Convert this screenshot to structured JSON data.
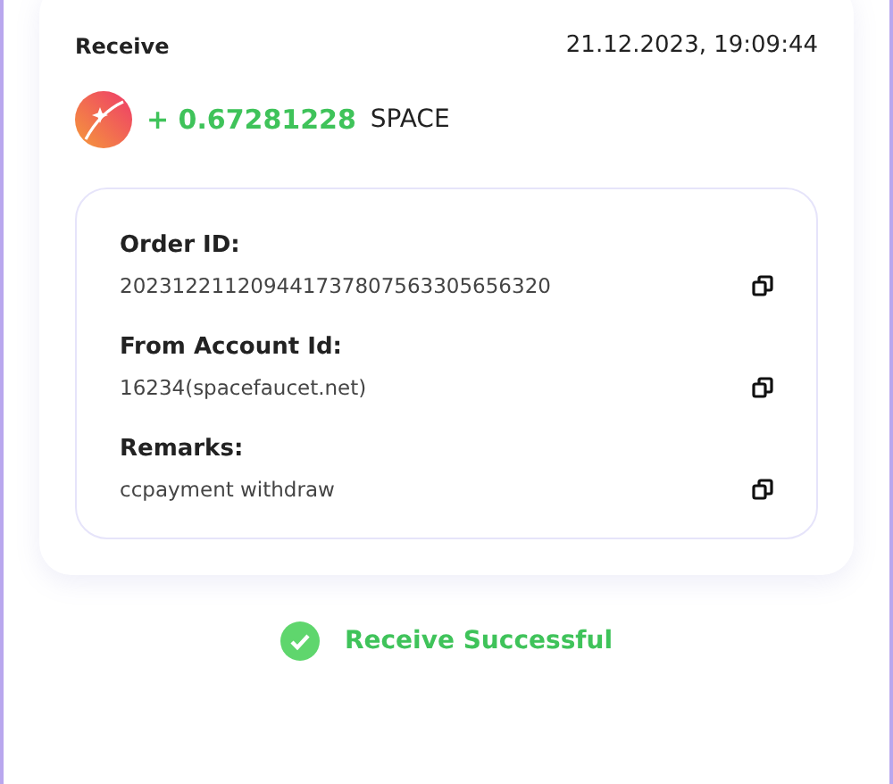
{
  "transaction": {
    "type": "Receive",
    "datetime": "21.12.2023, 19:09:44",
    "amount": "+ 0.67281228",
    "currency": "SPACE"
  },
  "details": [
    {
      "label": "Order ID:",
      "value": "202312211209441737807563305656320"
    },
    {
      "label": "From Account Id:",
      "value": "16234(spacefaucet.net)"
    },
    {
      "label": "Remarks:",
      "value": "ccpayment withdraw"
    }
  ],
  "status": {
    "text": "Receive Successful",
    "success": true
  }
}
